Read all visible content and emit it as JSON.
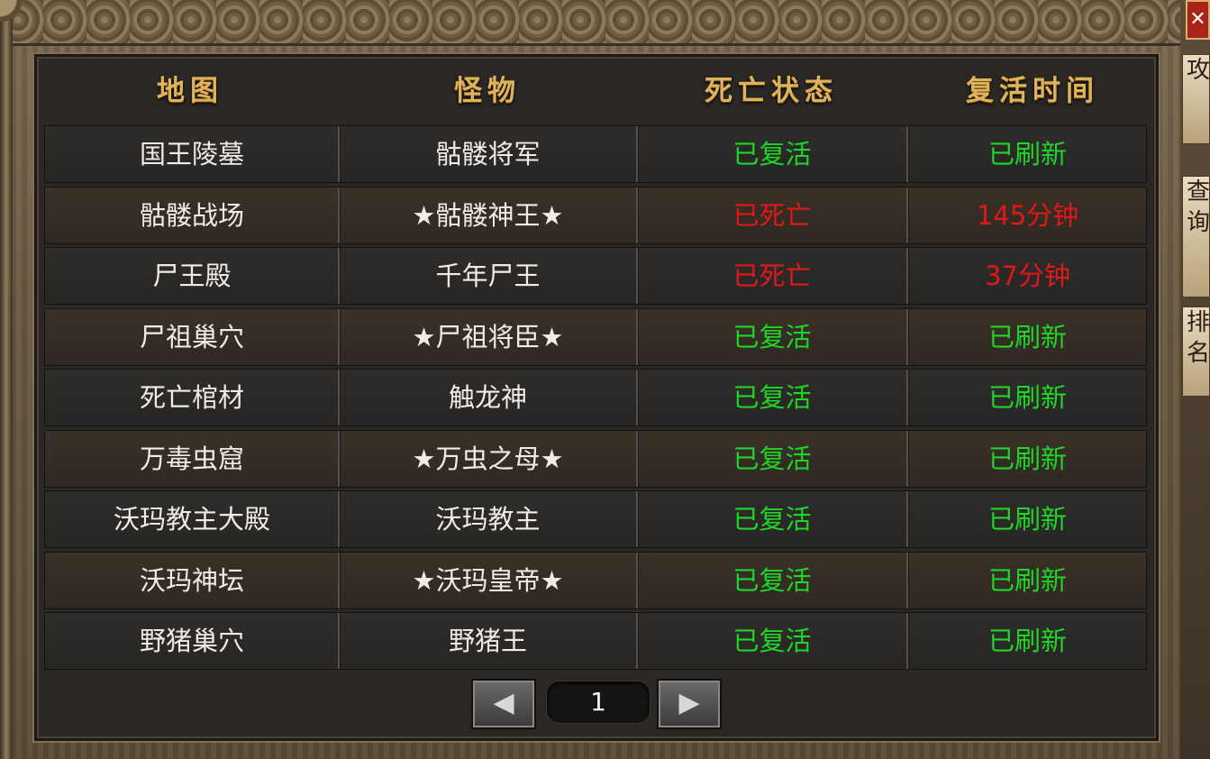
{
  "headers": [
    "地图",
    "怪物",
    "死亡状态",
    "复活时间"
  ],
  "rows": [
    {
      "map": "国王陵墓",
      "monster": "骷髅将军",
      "status": "已复活",
      "respawn": "已刷新",
      "alive": true
    },
    {
      "map": "骷髅战场",
      "monster": "★骷髅神王★",
      "status": "已死亡",
      "respawn": "145分钟",
      "alive": false
    },
    {
      "map": "尸王殿",
      "monster": "千年尸王",
      "status": "已死亡",
      "respawn": "37分钟",
      "alive": false
    },
    {
      "map": "尸祖巢穴",
      "monster": "★尸祖将臣★",
      "status": "已复活",
      "respawn": "已刷新",
      "alive": true
    },
    {
      "map": "死亡棺材",
      "monster": "触龙神",
      "status": "已复活",
      "respawn": "已刷新",
      "alive": true
    },
    {
      "map": "万毒虫窟",
      "monster": "★万虫之母★",
      "status": "已复活",
      "respawn": "已刷新",
      "alive": true
    },
    {
      "map": "沃玛教主大殿",
      "monster": "沃玛教主",
      "status": "已复活",
      "respawn": "已刷新",
      "alive": true
    },
    {
      "map": "沃玛神坛",
      "monster": "★沃玛皇帝★",
      "status": "已复活",
      "respawn": "已刷新",
      "alive": true
    },
    {
      "map": "野猪巢穴",
      "monster": "野猪王",
      "status": "已复活",
      "respawn": "已刷新",
      "alive": true
    }
  ],
  "pager": {
    "page": "1",
    "prev_icon": "◀",
    "next_icon": "▶"
  },
  "side": {
    "close_icon": "✕",
    "tab1": "攻略",
    "tab2": "查询",
    "tab3": "排名"
  },
  "colors": {
    "alive": "#1ed626",
    "dead": "#e01818",
    "header": "#e0b25a"
  }
}
